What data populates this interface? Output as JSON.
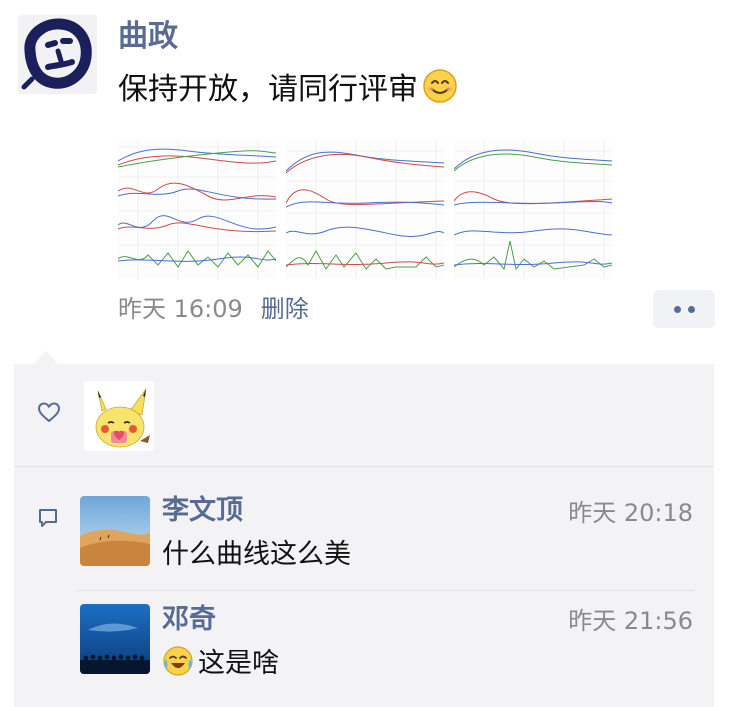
{
  "post": {
    "author": "曲政",
    "text": "保持开放，请同行评审",
    "time": "昨天 16:09",
    "delete_label": "删除"
  },
  "likes": {
    "count_avatars": 1
  },
  "comments": [
    {
      "name": "李文顶",
      "time": "昨天 20:18",
      "text": "什么曲线这么美"
    },
    {
      "name": "邓奇",
      "time": "昨天 21:56",
      "text": "这是啥"
    }
  ],
  "colors": {
    "link_blue": "#576b95",
    "panel_bg": "#f3f3f6",
    "meta_gray": "#8a8a8a"
  },
  "icons": {
    "smile": "smiling-face-emoji",
    "crying": "crying-laughing-emoji",
    "like": "heart-outline-icon",
    "comment": "speech-bubble-icon"
  }
}
